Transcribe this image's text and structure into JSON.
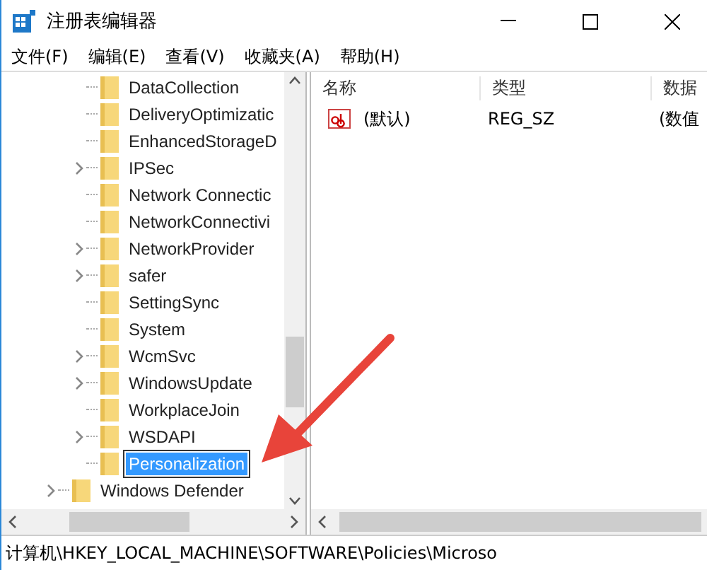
{
  "window": {
    "title": "注册表编辑器"
  },
  "menu": [
    "文件(F)",
    "编辑(E)",
    "查看(V)",
    "收藏夹(A)",
    "帮助(H)"
  ],
  "tree": {
    "items": [
      {
        "children": [
          {
            "label": "DataCollection",
            "expandable": false,
            "selected": false
          },
          {
            "label": "DeliveryOptimizatic",
            "expandable": false,
            "selected": false
          },
          {
            "label": "EnhancedStorageD",
            "expandable": false,
            "selected": false
          },
          {
            "label": "IPSec",
            "expandable": true,
            "selected": false
          },
          {
            "label": "Network Connectic",
            "expandable": false,
            "selected": false
          },
          {
            "label": "NetworkConnectivi",
            "expandable": false,
            "selected": false
          },
          {
            "label": "NetworkProvider",
            "expandable": true,
            "selected": false
          },
          {
            "label": "safer",
            "expandable": true,
            "selected": false
          },
          {
            "label": "SettingSync",
            "expandable": false,
            "selected": false
          },
          {
            "label": "System",
            "expandable": false,
            "selected": false
          },
          {
            "label": "WcmSvc",
            "expandable": true,
            "selected": false
          },
          {
            "label": "WindowsUpdate",
            "expandable": true,
            "selected": false
          },
          {
            "label": "WorkplaceJoin",
            "expandable": false,
            "selected": false
          },
          {
            "label": "WSDAPI",
            "expandable": true,
            "selected": false
          },
          {
            "label": "Personalization",
            "expandable": false,
            "selected": true
          }
        ]
      },
      {
        "label": "Windows Defender",
        "expandable": true,
        "selected": false
      }
    ]
  },
  "values": {
    "columns": [
      "名称",
      "类型",
      "数据"
    ],
    "rows": [
      {
        "name": "(默认)",
        "type": "REG_SZ",
        "data": "(数值"
      }
    ]
  },
  "status_bar": "计算机\\HKEY_LOCAL_MACHINE\\SOFTWARE\\Policies\\Microso"
}
